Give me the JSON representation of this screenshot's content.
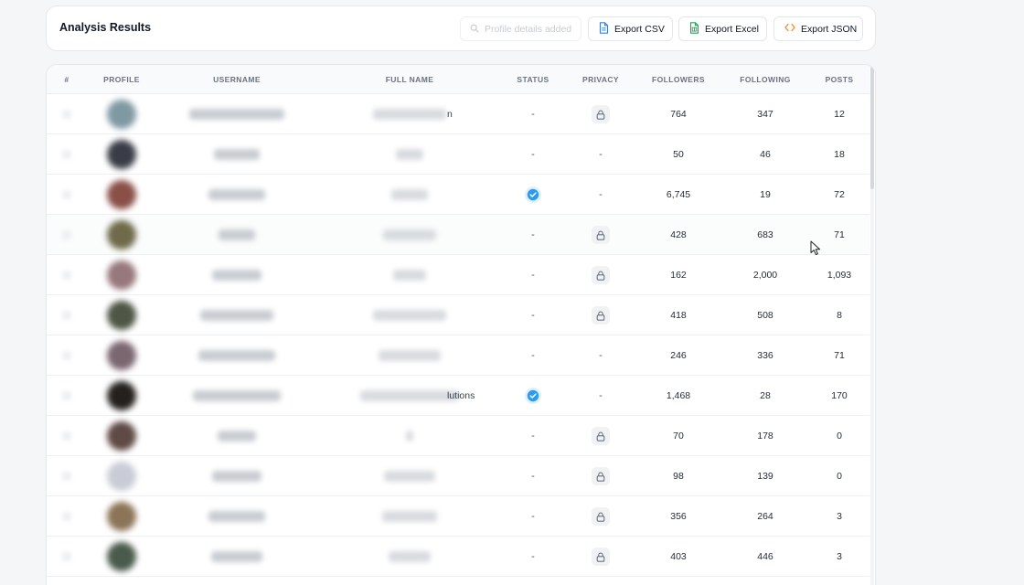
{
  "header": {
    "title": "Analysis Results",
    "search_placeholder": "Profile details added",
    "buttons": {
      "export_csv": "Export CSV",
      "export_excel": "Export Excel",
      "export_json": "Export JSON"
    }
  },
  "table": {
    "columns": [
      "#",
      "PROFILE",
      "USERNAME",
      "FULL NAME",
      "STATUS",
      "PRIVACY",
      "FOLLOWERS",
      "FOLLOWING",
      "POSTS"
    ],
    "rows": [
      {
        "fullname_suffix": "n",
        "status": "-",
        "privacy": "lock",
        "followers": "764",
        "following": "347",
        "posts": "12",
        "avatar_color": "#7f99a3"
      },
      {
        "fullname_suffix": "",
        "status": "-",
        "privacy": "-",
        "followers": "50",
        "following": "46",
        "posts": "18",
        "avatar_color": "#3a3d47"
      },
      {
        "fullname_suffix": "",
        "status": "verified",
        "privacy": "-",
        "followers": "6,745",
        "following": "19",
        "posts": "72",
        "avatar_color": "#8a5048"
      },
      {
        "fullname_suffix": "",
        "status": "-",
        "privacy": "lock",
        "followers": "428",
        "following": "683",
        "posts": "71",
        "avatar_color": "#6e6a4a"
      },
      {
        "fullname_suffix": "",
        "status": "-",
        "privacy": "lock",
        "followers": "162",
        "following": "2,000",
        "posts": "1,093",
        "avatar_color": "#97787c"
      },
      {
        "fullname_suffix": "",
        "status": "-",
        "privacy": "lock",
        "followers": "418",
        "following": "508",
        "posts": "8",
        "avatar_color": "#4f5645"
      },
      {
        "fullname_suffix": "",
        "status": "-",
        "privacy": "-",
        "followers": "246",
        "following": "336",
        "posts": "71",
        "avatar_color": "#7b6770"
      },
      {
        "fullname_suffix": "lutions",
        "status": "verified",
        "privacy": "-",
        "followers": "1,468",
        "following": "28",
        "posts": "170",
        "avatar_color": "#24201e"
      },
      {
        "fullname_suffix": "",
        "status": "-",
        "privacy": "lock",
        "followers": "70",
        "following": "178",
        "posts": "0",
        "avatar_color": "#5f4a45"
      },
      {
        "fullname_suffix": "",
        "status": "-",
        "privacy": "lock",
        "followers": "98",
        "following": "139",
        "posts": "0",
        "avatar_color": "#c9ccd6"
      },
      {
        "fullname_suffix": "",
        "status": "-",
        "privacy": "lock",
        "followers": "356",
        "following": "264",
        "posts": "3",
        "avatar_color": "#8b7458"
      },
      {
        "fullname_suffix": "",
        "status": "-",
        "privacy": "lock",
        "followers": "403",
        "following": "446",
        "posts": "3",
        "avatar_color": "#4a5a4c"
      }
    ]
  },
  "colors": {
    "verified": "#2b9bf0",
    "export_csv_icon": "#3b7ddd",
    "export_excel_icon": "#22a35a",
    "export_json_icon": "#f08a24"
  },
  "icons": {
    "search": "search-icon",
    "csv": "file-text-icon",
    "excel": "spreadsheet-icon",
    "json": "code-icon",
    "lock": "lock-icon",
    "verified": "verified-check-icon",
    "cursor": "mouse-pointer-icon"
  }
}
